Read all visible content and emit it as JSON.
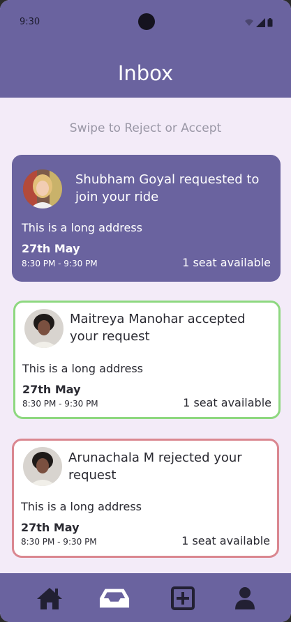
{
  "status_bar": {
    "time": "9:30"
  },
  "header": {
    "title": "Inbox"
  },
  "hint": "Swipe to Reject or Accept",
  "cards": [
    {
      "status": "pending",
      "message": "Shubham Goyal requested to join your ride",
      "address": "This is a long address",
      "date": "27th May",
      "time": "8:30 PM - 9:30 PM",
      "seats": "1 seat available"
    },
    {
      "status": "accepted",
      "message": "Maitreya Manohar accepted your request",
      "address": "This is a long address",
      "date": "27th May",
      "time": "8:30 PM - 9:30 PM",
      "seats": "1 seat available"
    },
    {
      "status": "rejected",
      "message": "Arunachala M rejected your request",
      "address": "This is a long address",
      "date": "27th May",
      "time": "8:30 PM - 9:30 PM",
      "seats": "1 seat available"
    }
  ],
  "nav": {
    "items": [
      "home-icon",
      "inbox-icon",
      "add-icon",
      "profile-icon"
    ],
    "active": "inbox-icon"
  },
  "colors": {
    "primary": "#6a639f",
    "background": "#f3ebf8",
    "accepted_border": "#8ed880",
    "rejected_border": "#da8790"
  }
}
